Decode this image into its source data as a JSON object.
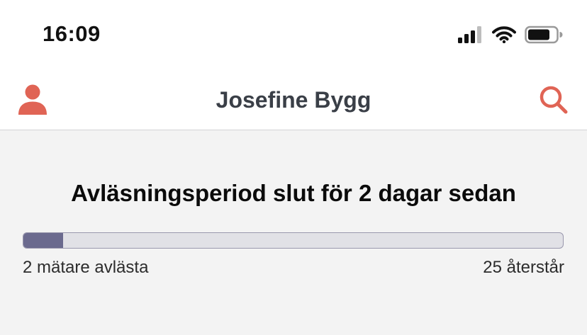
{
  "status_bar": {
    "time": "16:09",
    "icons": [
      "cellular-signal-icon",
      "wifi-icon",
      "battery-icon"
    ]
  },
  "header": {
    "title": "Josefine Bygg",
    "left_icon": "user-icon",
    "right_icon": "search-icon"
  },
  "reading_period": {
    "heading": "Avläsningsperiod slut för 2 dagar sedan",
    "progress_fraction": 0.074,
    "read_label": "2 mätare avlästa",
    "remaining_label": "25 återstår"
  },
  "colors": {
    "accent": "#e06455",
    "title_text": "#3a3f47",
    "progress_fill": "#6b6a8e",
    "progress_track": "#e1e1e6",
    "content_background": "#f3f3f3"
  }
}
